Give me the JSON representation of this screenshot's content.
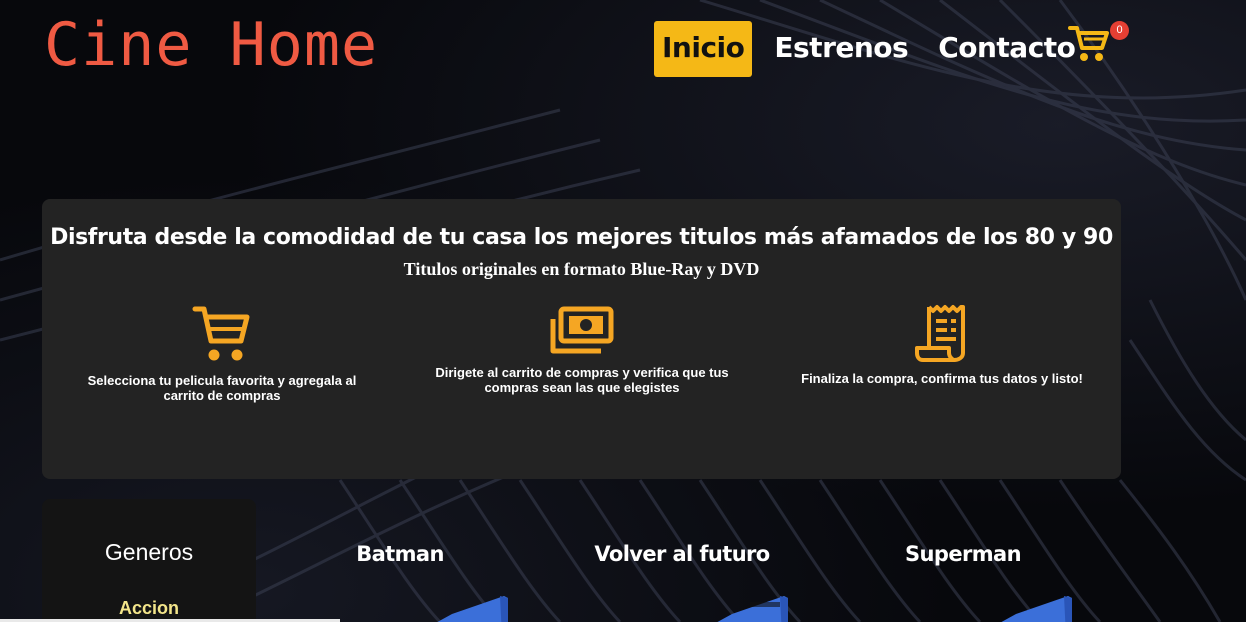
{
  "brand": {
    "logo_text": "Cine Home",
    "logo_color": "#ef5a43"
  },
  "nav": {
    "items": [
      {
        "label": "Inicio",
        "active": true
      },
      {
        "label": "Estrenos",
        "active": false
      },
      {
        "label": "Contacto",
        "active": false
      }
    ],
    "active_color": "#f5b816"
  },
  "cart": {
    "icon": "cart-icon",
    "count": "0"
  },
  "hero": {
    "title": "Disfruta desde la comodidad de tu casa los mejores titulos más afamados de los 80 y 90",
    "subtitle": "Titulos originales en formato Blue-Ray y DVD",
    "steps": [
      {
        "icon": "shopping-cart-icon",
        "text": "Selecciona tu pelicula favorita y agregala al carrito de compras"
      },
      {
        "icon": "money-bill-icon",
        "text": "Dirigete al carrito de compras y verifica que tus compras sean las que elegistes"
      },
      {
        "icon": "receipt-icon",
        "text": "Finaliza la compra, confirma tus datos y listo!"
      }
    ],
    "accent_color": "#f5a623"
  },
  "sidebar": {
    "title": "Generos",
    "items": [
      {
        "label": "Accion"
      }
    ]
  },
  "products": [
    {
      "title": "Batman"
    },
    {
      "title": "Volver al futuro"
    },
    {
      "title": "Superman"
    }
  ]
}
